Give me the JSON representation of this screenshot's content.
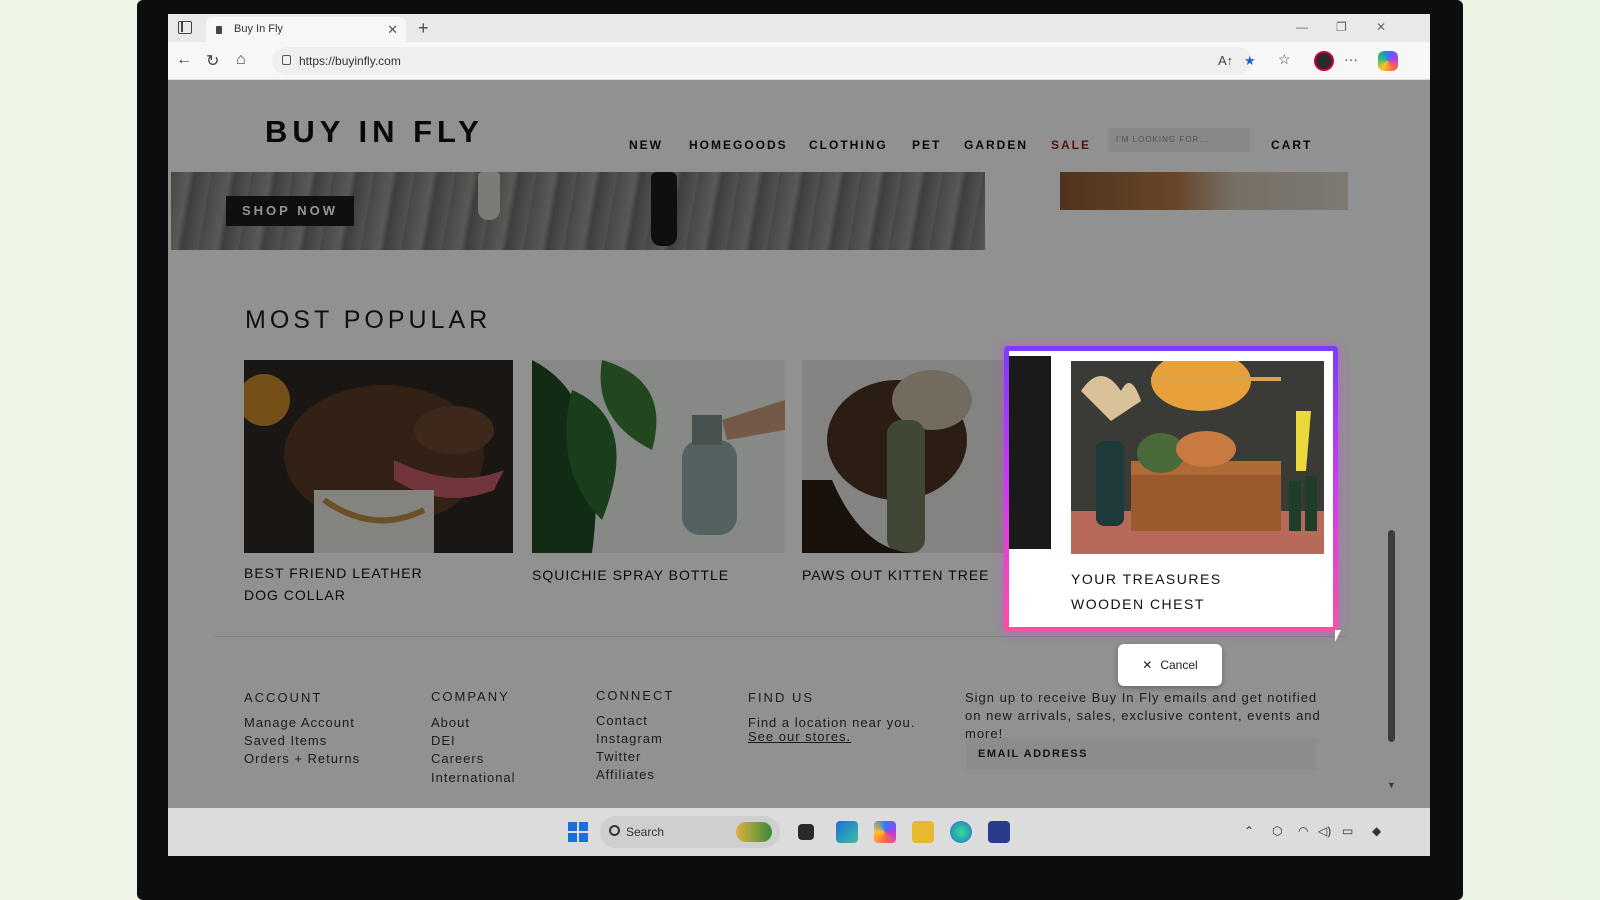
{
  "browser": {
    "tab_title": "Buy In Fly",
    "url": "https://buyinfly.com"
  },
  "site": {
    "logo": "BUY IN FLY",
    "nav": [
      "NEW",
      "HOMEGOODS",
      "CLOTHING",
      "PET",
      "GARDEN",
      "SALE"
    ],
    "search_placeholder": "I'M LOOKING FOR...",
    "cart": "CART",
    "hero_button": "SHOP NOW",
    "section_title": "MOST POPULAR",
    "products": [
      {
        "name": "BEST FRIEND LEATHER DOG COLLAR"
      },
      {
        "name": "SQUICHIE SPRAY BOTTLE"
      },
      {
        "name": "PAWS OUT KITTEN TREE"
      },
      {
        "name": "YOUR TREASURES WOODEN CHEST"
      }
    ],
    "footer": {
      "account": {
        "heading": "ACCOUNT",
        "links": [
          "Manage Account",
          "Saved Items",
          "Orders + Returns"
        ]
      },
      "company": {
        "heading": "COMPANY",
        "links": [
          "About",
          "DEI",
          "Careers",
          "International"
        ]
      },
      "connect": {
        "heading": "CONNECT",
        "links": [
          "Contact",
          "Instagram",
          "Twitter",
          "Affiliates"
        ]
      },
      "find_us": {
        "heading": "FIND US",
        "text": "Find a location near you.",
        "link": "See our stores."
      },
      "newsletter": {
        "text": "Sign up to receive Buy In Fly emails and get notified on new arrivals, sales, exclusive content, events and more!",
        "email_label": "EMAIL ADDRESS"
      }
    }
  },
  "overlay": {
    "cancel_label": "Cancel"
  },
  "taskbar": {
    "search_label": "Search"
  },
  "colors": {
    "highlight_start": "#7a3cff",
    "highlight_end": "#ff4fa0",
    "edge_star": "#1d5fd6"
  }
}
